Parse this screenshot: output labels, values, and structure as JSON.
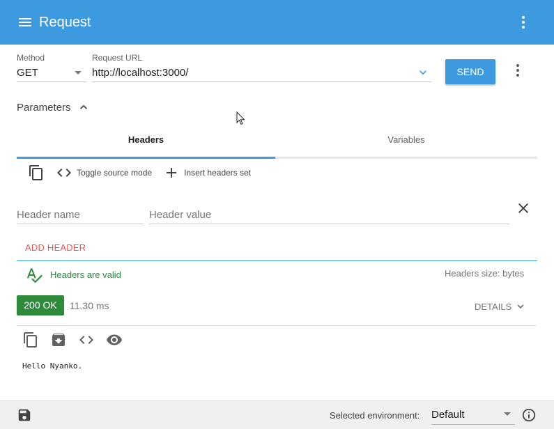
{
  "app": {
    "title": "Request"
  },
  "request": {
    "method_label": "Method",
    "method_value": "GET",
    "url_label": "Request URL",
    "url_value": "http://localhost:3000/",
    "send_label": "SEND"
  },
  "parameters": {
    "label": "Parameters",
    "expanded": true
  },
  "tabs": [
    {
      "label": "Headers",
      "active": true
    },
    {
      "label": "Variables",
      "active": false
    }
  ],
  "headers_toolbar": {
    "toggle_source_label": "Toggle source mode",
    "insert_set_label": "Insert headers set"
  },
  "header_row": {
    "name_placeholder": "Header name",
    "value_placeholder": "Header value"
  },
  "add_header_label": "ADD HEADER",
  "validation": {
    "valid_text": "Headers are valid",
    "size_text": "Headers size: bytes"
  },
  "response": {
    "status": "200 OK",
    "time": "11.30 ms",
    "details_label": "DETAILS",
    "body": "Hello Nyanko."
  },
  "footer": {
    "env_label": "Selected environment:",
    "env_value": "Default"
  },
  "colors": {
    "primary": "#3e9adf",
    "success": "#2e8b3c",
    "accent": "#ef5350"
  },
  "icons": [
    "menu-icon",
    "more-vert-icon",
    "chevron-down-icon",
    "chevron-up-icon",
    "copy-icon",
    "code-icon",
    "plus-icon",
    "close-icon",
    "spellcheck-icon",
    "archive-icon",
    "eye-icon",
    "save-icon",
    "info-icon",
    "cursor-icon"
  ]
}
